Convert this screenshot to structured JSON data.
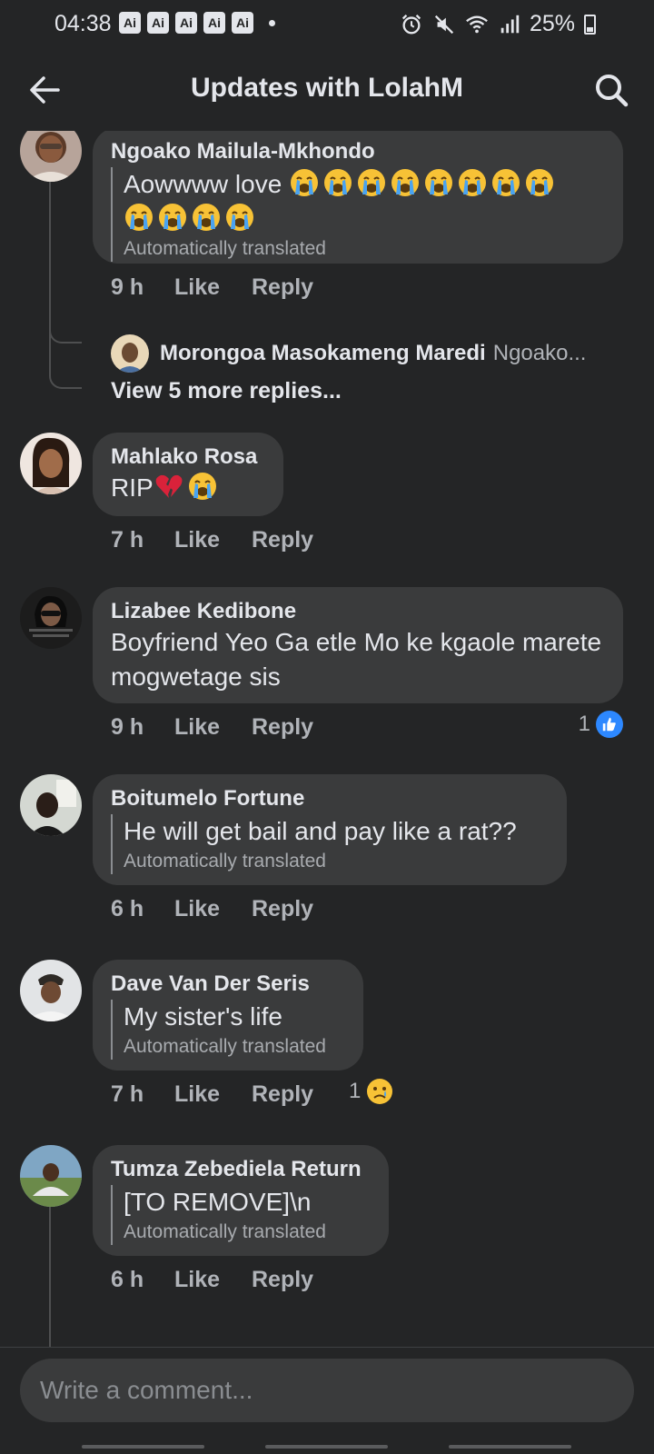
{
  "status_bar": {
    "time": "04:38",
    "badges": [
      "Ai",
      "Ai",
      "Ai",
      "Ai",
      "Ai"
    ],
    "battery": "25%"
  },
  "header": {
    "title": "Updates with LolahM"
  },
  "comments": [
    {
      "name": "Ngoako Mailula-Mkhondo",
      "text": "Aowwww love",
      "translated_label": "Automatically translated",
      "time": "9 h",
      "like": "Like",
      "reply": "Reply",
      "reply_preview": {
        "name": "Morongoa Masokameng Maredi",
        "text": "Ngoako..."
      },
      "view_more": "View 5 more replies..."
    },
    {
      "name": "Mahlako Rosa",
      "text": "RIP",
      "time": "7 h",
      "like": "Like",
      "reply": "Reply"
    },
    {
      "name": "Lizabee Kedibone",
      "text": "Boyfriend Yeo Ga etle Mo ke kgaole marete mogwetage sis",
      "time": "9 h",
      "like": "Like",
      "reply": "Reply",
      "reaction_count": "1"
    },
    {
      "name": "Boitumelo Fortune",
      "text": "He will get bail and pay like a rat??",
      "translated_label": "Automatically translated",
      "time": "6 h",
      "like": "Like",
      "reply": "Reply"
    },
    {
      "name": "Dave Van Der Seris",
      "text": "My sister's life",
      "translated_label": "Automatically translated",
      "time": "7 h",
      "like": "Like",
      "reply": "Reply",
      "reaction_count": "1"
    },
    {
      "name": "Tumza Zebediela Return",
      "text": "[TO REMOVE]\\n",
      "translated_label": "Automatically translated",
      "time": "6 h",
      "like": "Like",
      "reply": "Reply"
    }
  ],
  "composer": {
    "placeholder": "Write a comment..."
  },
  "colors": {
    "background": "#242526",
    "bubble": "#3a3b3c",
    "like_blue": "#2d88ff",
    "secondary_text": "#b0b3b8"
  }
}
